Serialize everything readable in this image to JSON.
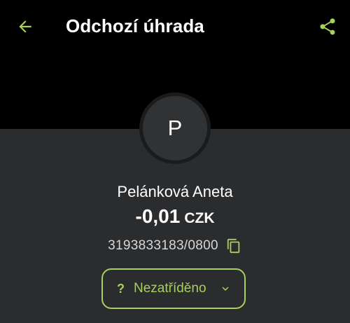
{
  "header": {
    "title": "Odchozí úhrada",
    "back_icon": "arrow-left-icon",
    "share_icon": "share-icon"
  },
  "contact": {
    "avatar_initial": "P",
    "name": "Pelánková Aneta"
  },
  "transaction": {
    "amount": "-0,01",
    "currency": "CZK",
    "account_number": "3193833183/0800",
    "copy_icon": "copy-icon"
  },
  "category": {
    "prefix": "?",
    "label": "Nezatříděno",
    "chevron_icon": "chevron-down-icon"
  },
  "colors": {
    "accent": "#a8d05a",
    "background": "#000000",
    "card": "#2b2c2e",
    "text": "#ffffff"
  }
}
